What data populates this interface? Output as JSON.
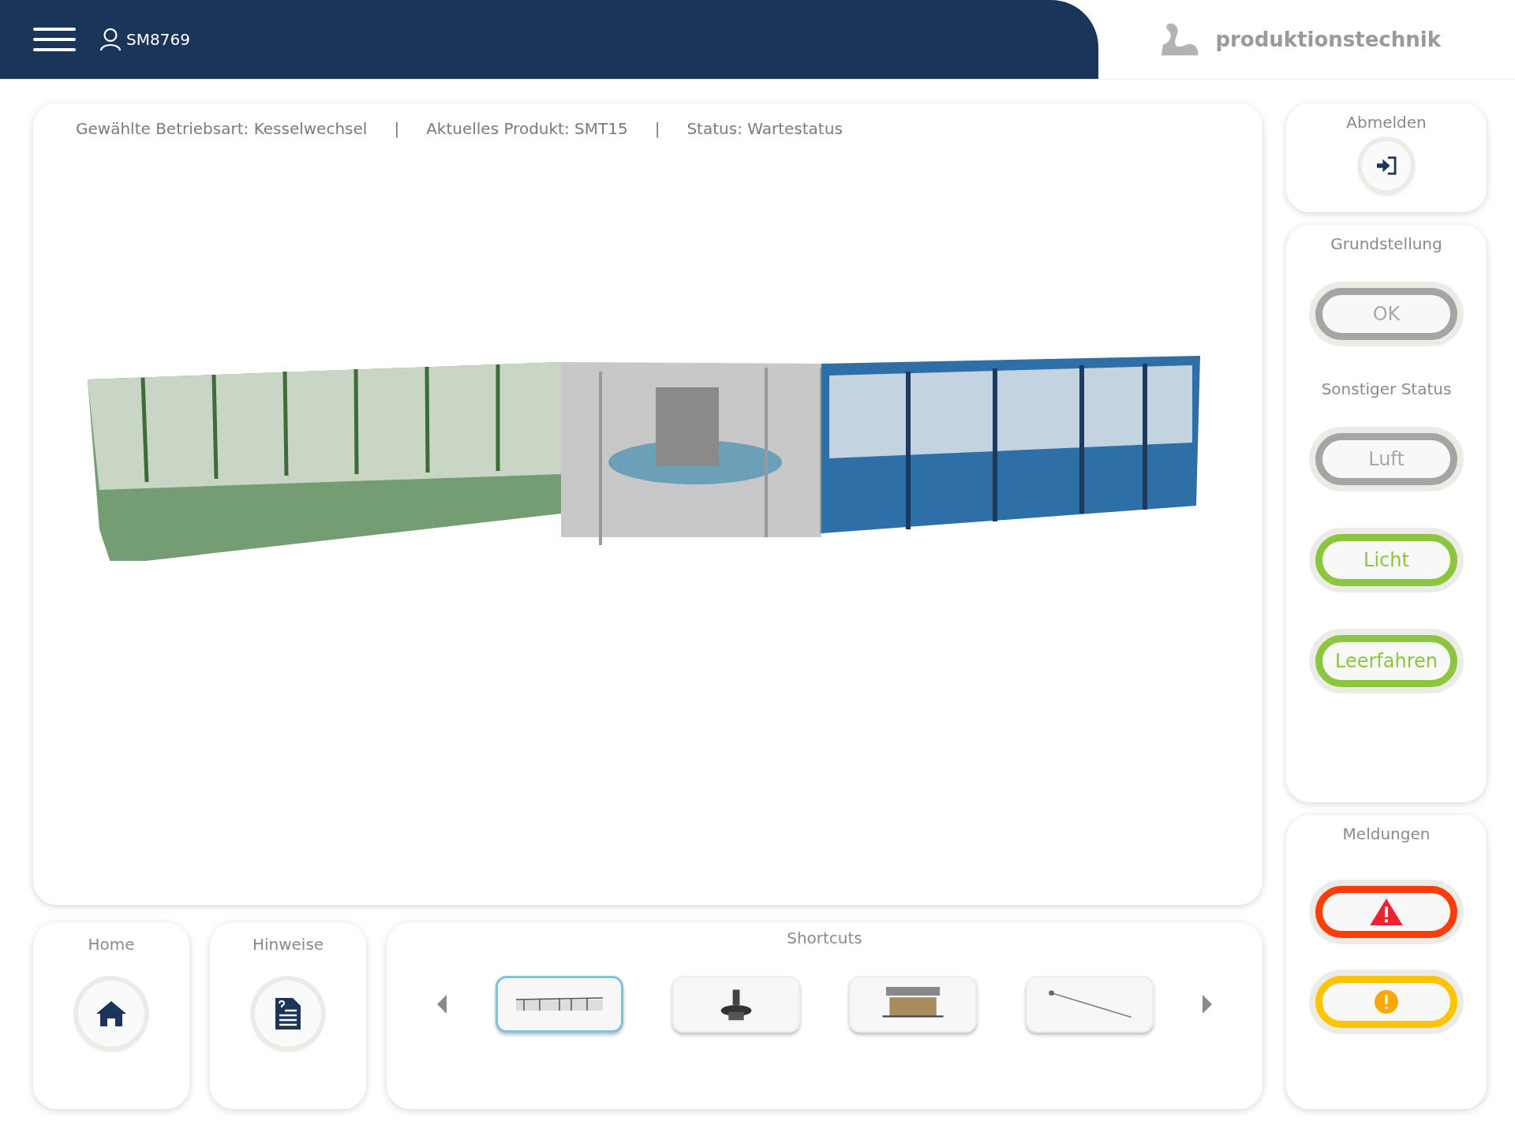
{
  "header": {
    "user": "SM8769",
    "brand": "produktionstechnik"
  },
  "info": {
    "separator": "|",
    "items": [
      "Gewählte Betriebsart: Kesselwechsel",
      "Aktuelles Produkt: SMT15",
      "Status: Wartestatus"
    ]
  },
  "logout": {
    "title": "Abmelden"
  },
  "basic": {
    "title": "Grundstellung",
    "button": {
      "label": "OK",
      "on": false
    }
  },
  "other": {
    "title": "Sonstiger Status",
    "buttons": [
      {
        "label": "Luft",
        "on": false
      },
      {
        "label": "Licht",
        "on": true
      },
      {
        "label": "Leerfahren",
        "on": true
      }
    ]
  },
  "messages": {
    "title": "Meldungen",
    "buttons": [
      {
        "kind": "error"
      },
      {
        "kind": "warning"
      }
    ]
  },
  "home": {
    "title": "Home"
  },
  "notes": {
    "title": "Hinweise"
  },
  "shortcuts": {
    "title": "Shortcuts",
    "items": [
      {
        "kind": "line",
        "selected": true
      },
      {
        "kind": "carousel",
        "selected": false
      },
      {
        "kind": "rack",
        "selected": false
      },
      {
        "kind": "rod",
        "selected": false
      }
    ]
  }
}
